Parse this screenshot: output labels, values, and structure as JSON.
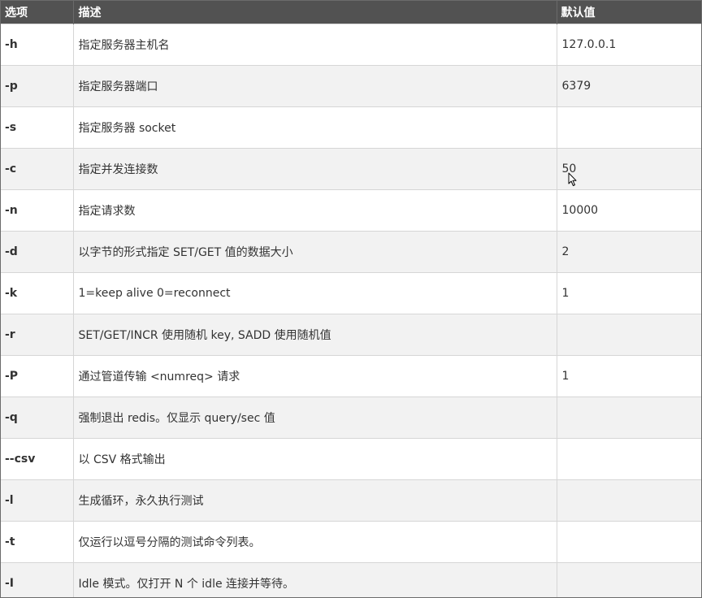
{
  "table": {
    "headers": {
      "option": "选项",
      "description": "描述",
      "default": "默认值"
    },
    "rows": [
      {
        "option": "-h",
        "description": "指定服务器主机名",
        "default": "127.0.0.1"
      },
      {
        "option": "-p",
        "description": "指定服务器端口",
        "default": "6379"
      },
      {
        "option": "-s",
        "description": "指定服务器 socket",
        "default": ""
      },
      {
        "option": "-c",
        "description": "指定并发连接数",
        "default": "50"
      },
      {
        "option": "-n",
        "description": "指定请求数",
        "default": "10000"
      },
      {
        "option": "-d",
        "description": "以字节的形式指定 SET/GET 值的数据大小",
        "default": "2"
      },
      {
        "option": "-k",
        "description": "1=keep alive 0=reconnect",
        "default": "1"
      },
      {
        "option": "-r",
        "description": "SET/GET/INCR 使用随机 key, SADD 使用随机值",
        "default": ""
      },
      {
        "option": "-P",
        "description": "通过管道传输 <numreq> 请求",
        "default": "1"
      },
      {
        "option": "-q",
        "description": "强制退出 redis。仅显示 query/sec 值",
        "default": ""
      },
      {
        "option": "--csv",
        "description": "以 CSV 格式输出",
        "default": ""
      },
      {
        "option": "-l",
        "description": "生成循环，永久执行测试",
        "default": ""
      },
      {
        "option": "-t",
        "description": "仅运行以逗号分隔的测试命令列表。",
        "default": ""
      },
      {
        "option": "-I",
        "description": "Idle 模式。仅打开 N 个 idle 连接并等待。",
        "default": ""
      }
    ]
  },
  "cursor": {
    "icon": "mouse-pointer-icon"
  }
}
